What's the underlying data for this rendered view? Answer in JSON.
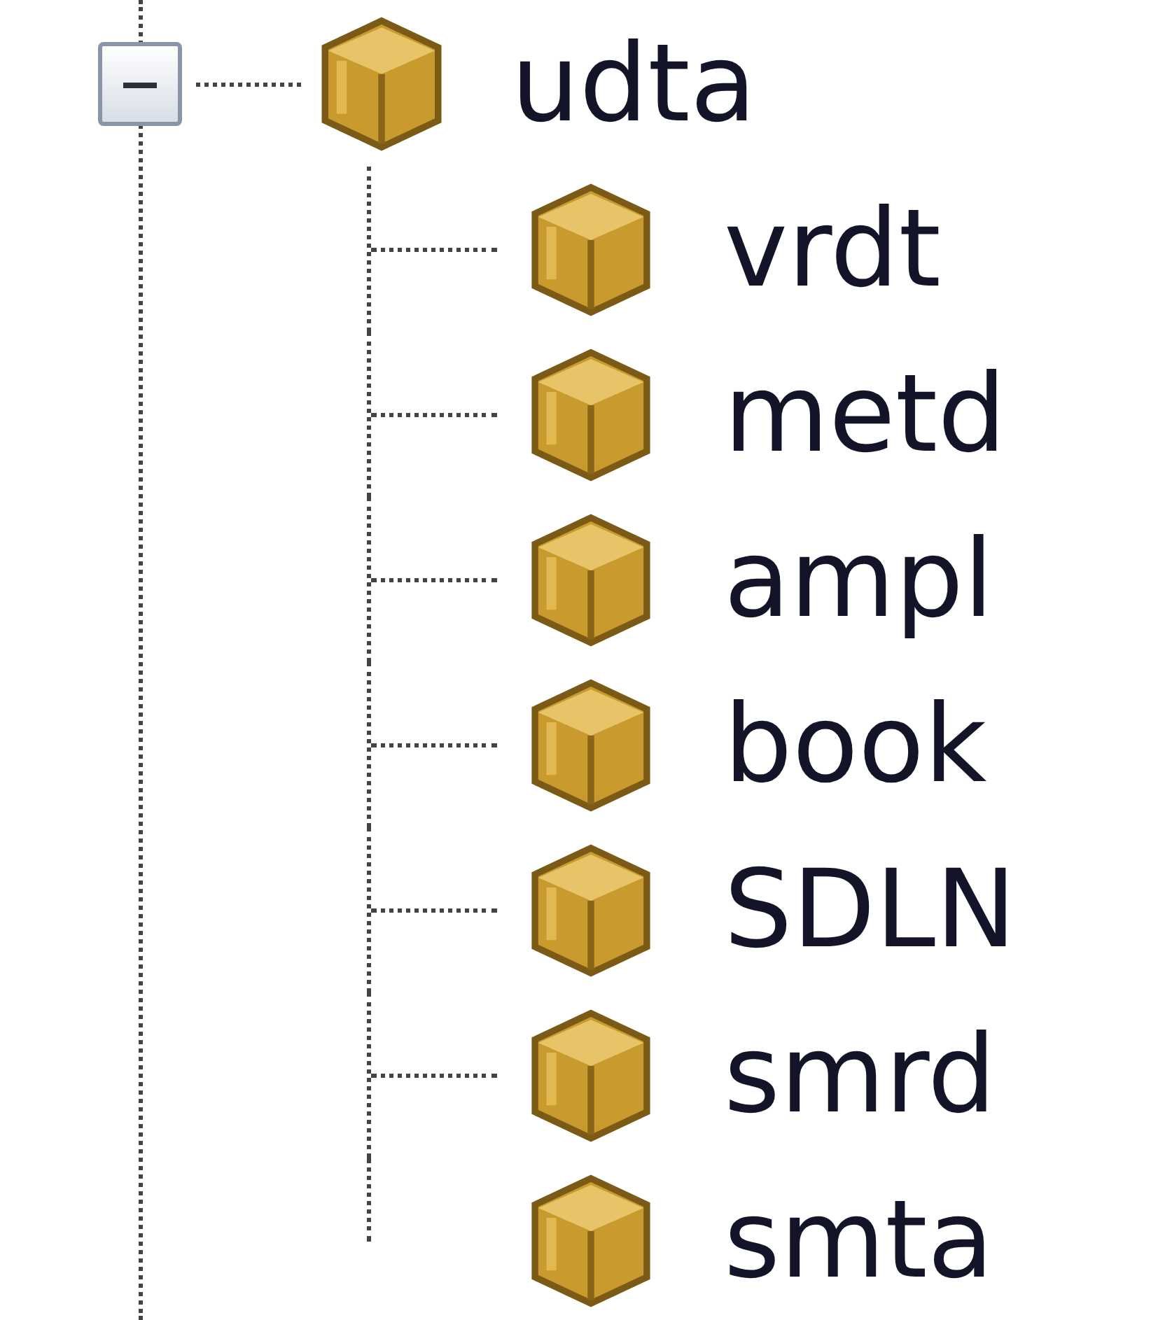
{
  "tree": [
    {
      "label": "udta",
      "expanded": true,
      "children": [
        {
          "label": "vrdt"
        },
        {
          "label": "metd"
        },
        {
          "label": "ampl"
        },
        {
          "label": "book"
        },
        {
          "label": "SDLN"
        },
        {
          "label": "smrd"
        },
        {
          "label": "smta"
        }
      ]
    }
  ]
}
